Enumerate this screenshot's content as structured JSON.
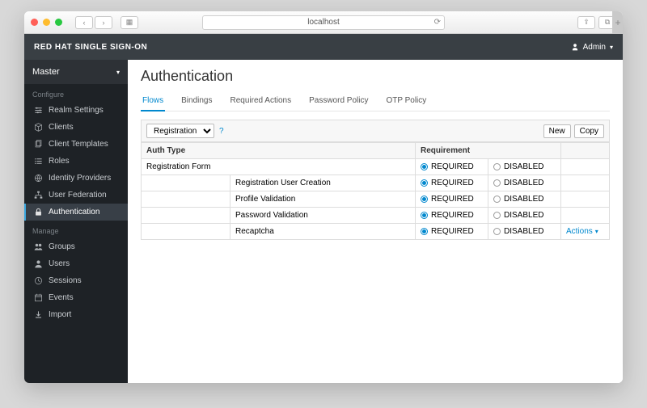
{
  "browser": {
    "url": "localhost"
  },
  "topbar": {
    "brand": "RED HAT SINGLE SIGN-ON",
    "user": "Admin"
  },
  "realm": {
    "name": "Master"
  },
  "sidebar": {
    "configure_label": "Configure",
    "manage_label": "Manage",
    "configure": [
      {
        "label": "Realm Settings",
        "icon": "sliders"
      },
      {
        "label": "Clients",
        "icon": "cube"
      },
      {
        "label": "Client Templates",
        "icon": "copy"
      },
      {
        "label": "Roles",
        "icon": "list"
      },
      {
        "label": "Identity Providers",
        "icon": "globe"
      },
      {
        "label": "User Federation",
        "icon": "sitemap"
      },
      {
        "label": "Authentication",
        "icon": "lock"
      }
    ],
    "manage": [
      {
        "label": "Groups",
        "icon": "users"
      },
      {
        "label": "Users",
        "icon": "user"
      },
      {
        "label": "Sessions",
        "icon": "clock"
      },
      {
        "label": "Events",
        "icon": "calendar"
      },
      {
        "label": "Import",
        "icon": "download"
      }
    ]
  },
  "page": {
    "title": "Authentication",
    "tabs": [
      "Flows",
      "Bindings",
      "Required Actions",
      "Password Policy",
      "OTP Policy"
    ],
    "active_tab": 0
  },
  "toolbar": {
    "flow_select": "Registration",
    "new_label": "New",
    "copy_label": "Copy"
  },
  "table": {
    "headers": {
      "auth_type": "Auth Type",
      "requirement": "Requirement"
    },
    "req_labels": {
      "required": "REQUIRED",
      "disabled": "DISABLED"
    },
    "actions_label": "Actions",
    "rows": [
      {
        "name": "Registration Form",
        "indent": 0,
        "required": true,
        "actions": false
      },
      {
        "name": "Registration User Creation",
        "indent": 1,
        "required": true,
        "actions": false
      },
      {
        "name": "Profile Validation",
        "indent": 1,
        "required": true,
        "actions": false
      },
      {
        "name": "Password Validation",
        "indent": 1,
        "required": true,
        "actions": false
      },
      {
        "name": "Recaptcha",
        "indent": 1,
        "required": true,
        "actions": true
      }
    ]
  }
}
